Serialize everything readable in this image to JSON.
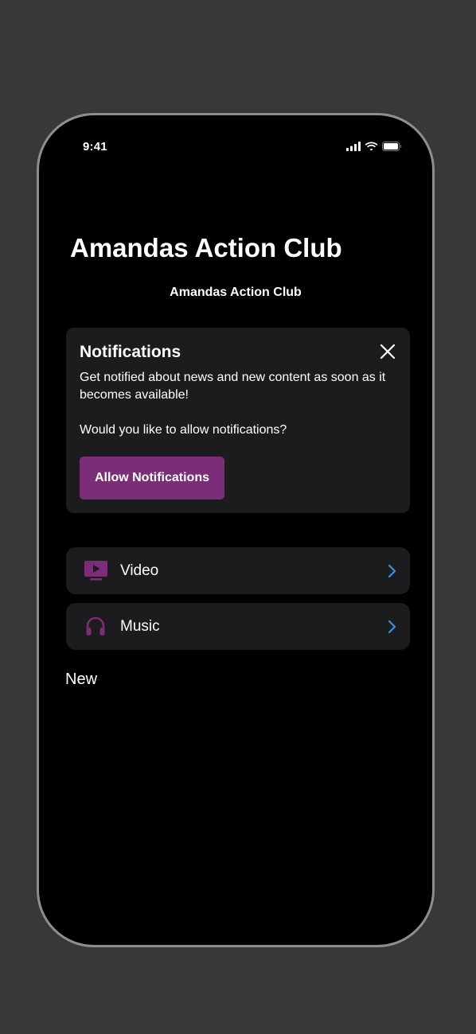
{
  "status_bar": {
    "time": "9:41"
  },
  "header": {
    "large_title": "Amandas Action Club",
    "nav_title": "Amandas Action Club"
  },
  "notification_card": {
    "title": "Notifications",
    "body": "Get notified about news and new content as soon as it becomes available!",
    "question": "Would you like to allow notifications?",
    "button_label": "Allow Notifications"
  },
  "menu": {
    "items": [
      {
        "label": "Video",
        "icon": "tv-play-icon"
      },
      {
        "label": "Music",
        "icon": "headphones-icon"
      }
    ]
  },
  "sections": {
    "new_title": "New"
  },
  "colors": {
    "accent": "#7b2d78",
    "chevron": "#3b8fe0",
    "card_background": "#1c1c1e",
    "screen_background": "#000000"
  }
}
